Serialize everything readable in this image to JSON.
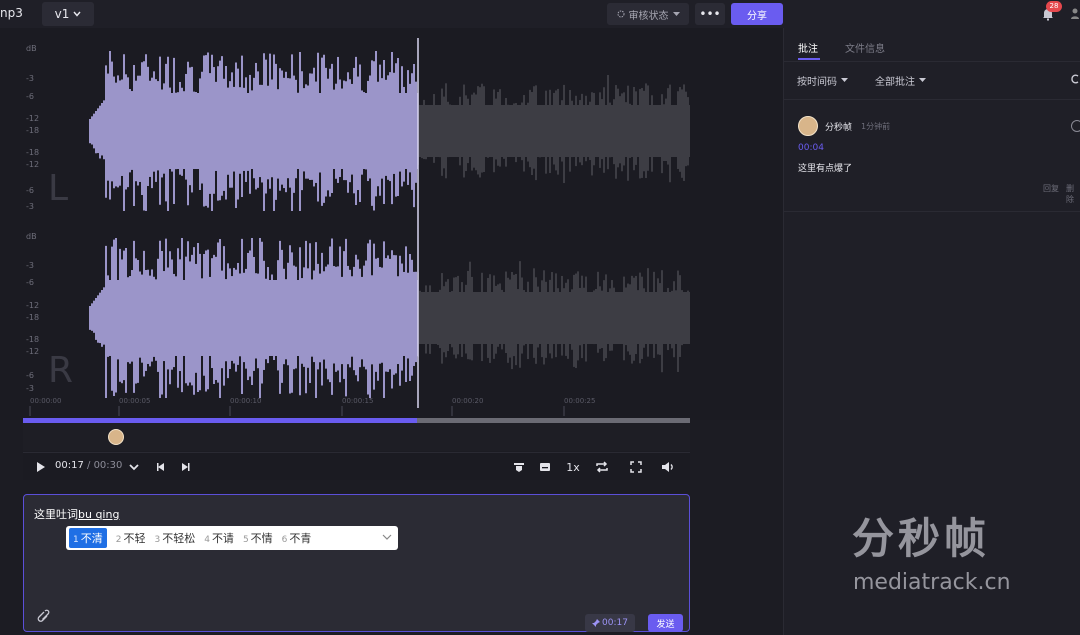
{
  "header": {
    "file_name": "np3",
    "version": "v1",
    "review_status": "审核状态",
    "more": "•••",
    "share": "分享",
    "notification_count": "28"
  },
  "waveform": {
    "db_labels_L": [
      "dB",
      "-3",
      "-6",
      "-12",
      "-18",
      "-18",
      "-12",
      "-6",
      "-3"
    ],
    "db_labels_R": [
      "dB",
      "-3",
      "-6",
      "-12",
      "-18",
      "-18",
      "-12",
      "-6",
      "-3"
    ],
    "channel_left": "L",
    "channel_right": "R",
    "time_ticks": [
      "00:00:00",
      "00:00:05",
      "00:00:10",
      "00:00:15",
      "00:00:20",
      "00:00:25"
    ],
    "played_color": "#9b95c9",
    "unplayed_color": "#3d3d44"
  },
  "player": {
    "progress": 0.59,
    "current_time": "00:17",
    "total_time": "/ 00:30",
    "speed": "1x",
    "icons": [
      "play-icon",
      "chevron-down-icon",
      "prev-frame-icon",
      "next-frame-icon",
      "marker-icon",
      "subtitle-icon",
      "loop-icon",
      "fullscreen-icon",
      "volume-icon"
    ]
  },
  "composer": {
    "typed_text": "这里吐词",
    "pinyin": "bu qing",
    "candidates": [
      {
        "num": "1",
        "text": "不清"
      },
      {
        "num": "2",
        "text": "不轻"
      },
      {
        "num": "3",
        "text": "不轻松"
      },
      {
        "num": "4",
        "text": "不请"
      },
      {
        "num": "5",
        "text": "不情"
      },
      {
        "num": "6",
        "text": "不青"
      }
    ],
    "time_tag": "00:17",
    "send": "发送"
  },
  "panel": {
    "tab_comments": "批注",
    "tab_file_info": "文件信息",
    "filter_sort": "按时间码",
    "filter_all": "全部批注",
    "comment": {
      "author": "分秒帧",
      "time_ago": "1分钟前",
      "timestamp": "00:04",
      "body": "这里有点爆了",
      "reply": "回复",
      "delete": "删除"
    }
  },
  "watermark": {
    "title": "分秒帧",
    "url": "mediatrack.cn"
  }
}
